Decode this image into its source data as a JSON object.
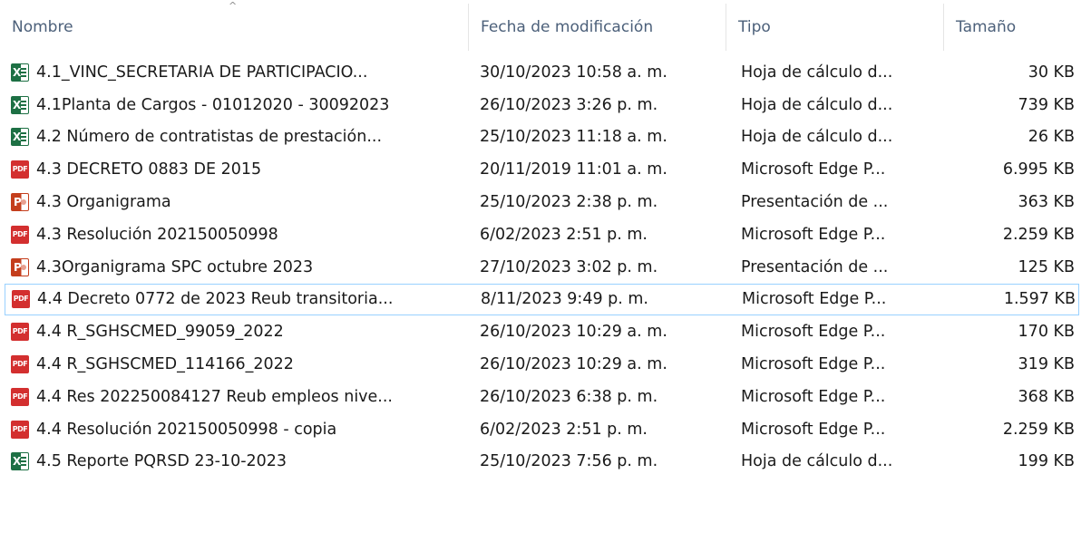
{
  "columns": {
    "name": "Nombre",
    "date": "Fecha de modificación",
    "type": "Tipo",
    "size": "Tamaño",
    "sort_indicator": "^"
  },
  "files": [
    {
      "icon": "excel-icon",
      "name": "4.1_VINC_SECRETARIA DE PARTICIPACIO...",
      "date": "30/10/2023 10:58 a. m.",
      "type": "Hoja de cálculo d...",
      "size": "30 KB"
    },
    {
      "icon": "excel-icon",
      "name": "4.1Planta de Cargos - 01012020 - 30092023",
      "date": "26/10/2023 3:26 p. m.",
      "type": "Hoja de cálculo d...",
      "size": "739 KB"
    },
    {
      "icon": "excel-icon",
      "name": "4.2 Número de contratistas de prestación...",
      "date": "25/10/2023 11:18 a. m.",
      "type": "Hoja de cálculo d...",
      "size": "26 KB"
    },
    {
      "icon": "pdf-icon",
      "name": "4.3 DECRETO 0883 DE 2015",
      "date": "20/11/2019 11:01 a. m.",
      "type": "Microsoft Edge P...",
      "size": "6.995 KB"
    },
    {
      "icon": "powerpoint-icon",
      "name": "4.3 Organigrama",
      "date": "25/10/2023 2:38 p. m.",
      "type": "Presentación de ...",
      "size": "363 KB"
    },
    {
      "icon": "pdf-icon",
      "name": "4.3 Resolución 202150050998",
      "date": "6/02/2023 2:51 p. m.",
      "type": "Microsoft Edge P...",
      "size": "2.259 KB"
    },
    {
      "icon": "powerpoint-icon",
      "name": "4.3Organigrama SPC octubre 2023",
      "date": "27/10/2023 3:02 p. m.",
      "type": "Presentación de ...",
      "size": "125 KB"
    },
    {
      "icon": "pdf-icon",
      "name": "4.4 Decreto 0772 de 2023 Reub transitoria...",
      "date": "8/11/2023 9:49 p. m.",
      "type": "Microsoft Edge P...",
      "size": "1.597 KB",
      "selected": true
    },
    {
      "icon": "pdf-icon",
      "name": "4.4 R_SGHSCMED_99059_2022",
      "date": "26/10/2023 10:29 a. m.",
      "type": "Microsoft Edge P...",
      "size": "170 KB"
    },
    {
      "icon": "pdf-icon",
      "name": "4.4 R_SGHSCMED_114166_2022",
      "date": "26/10/2023 10:29 a. m.",
      "type": "Microsoft Edge P...",
      "size": "319 KB"
    },
    {
      "icon": "pdf-icon",
      "name": "4.4 Res  202250084127 Reub empleos nive...",
      "date": "26/10/2023 6:38 p. m.",
      "type": "Microsoft Edge P...",
      "size": "368 KB"
    },
    {
      "icon": "pdf-icon",
      "name": "4.4 Resolución 202150050998 - copia",
      "date": "6/02/2023 2:51 p. m.",
      "type": "Microsoft Edge P...",
      "size": "2.259 KB"
    },
    {
      "icon": "excel-icon",
      "name": "4.5 Reporte PQRSD 23-10-2023",
      "date": "25/10/2023 7:56 p. m.",
      "type": "Hoja de cálculo d...",
      "size": "199 KB"
    }
  ],
  "colors": {
    "header_text": "#4c607a",
    "selection_border": "#99d1ff",
    "pdf": "#d32f2f",
    "excel": "#1d7044",
    "powerpoint": "#c43e1c"
  }
}
